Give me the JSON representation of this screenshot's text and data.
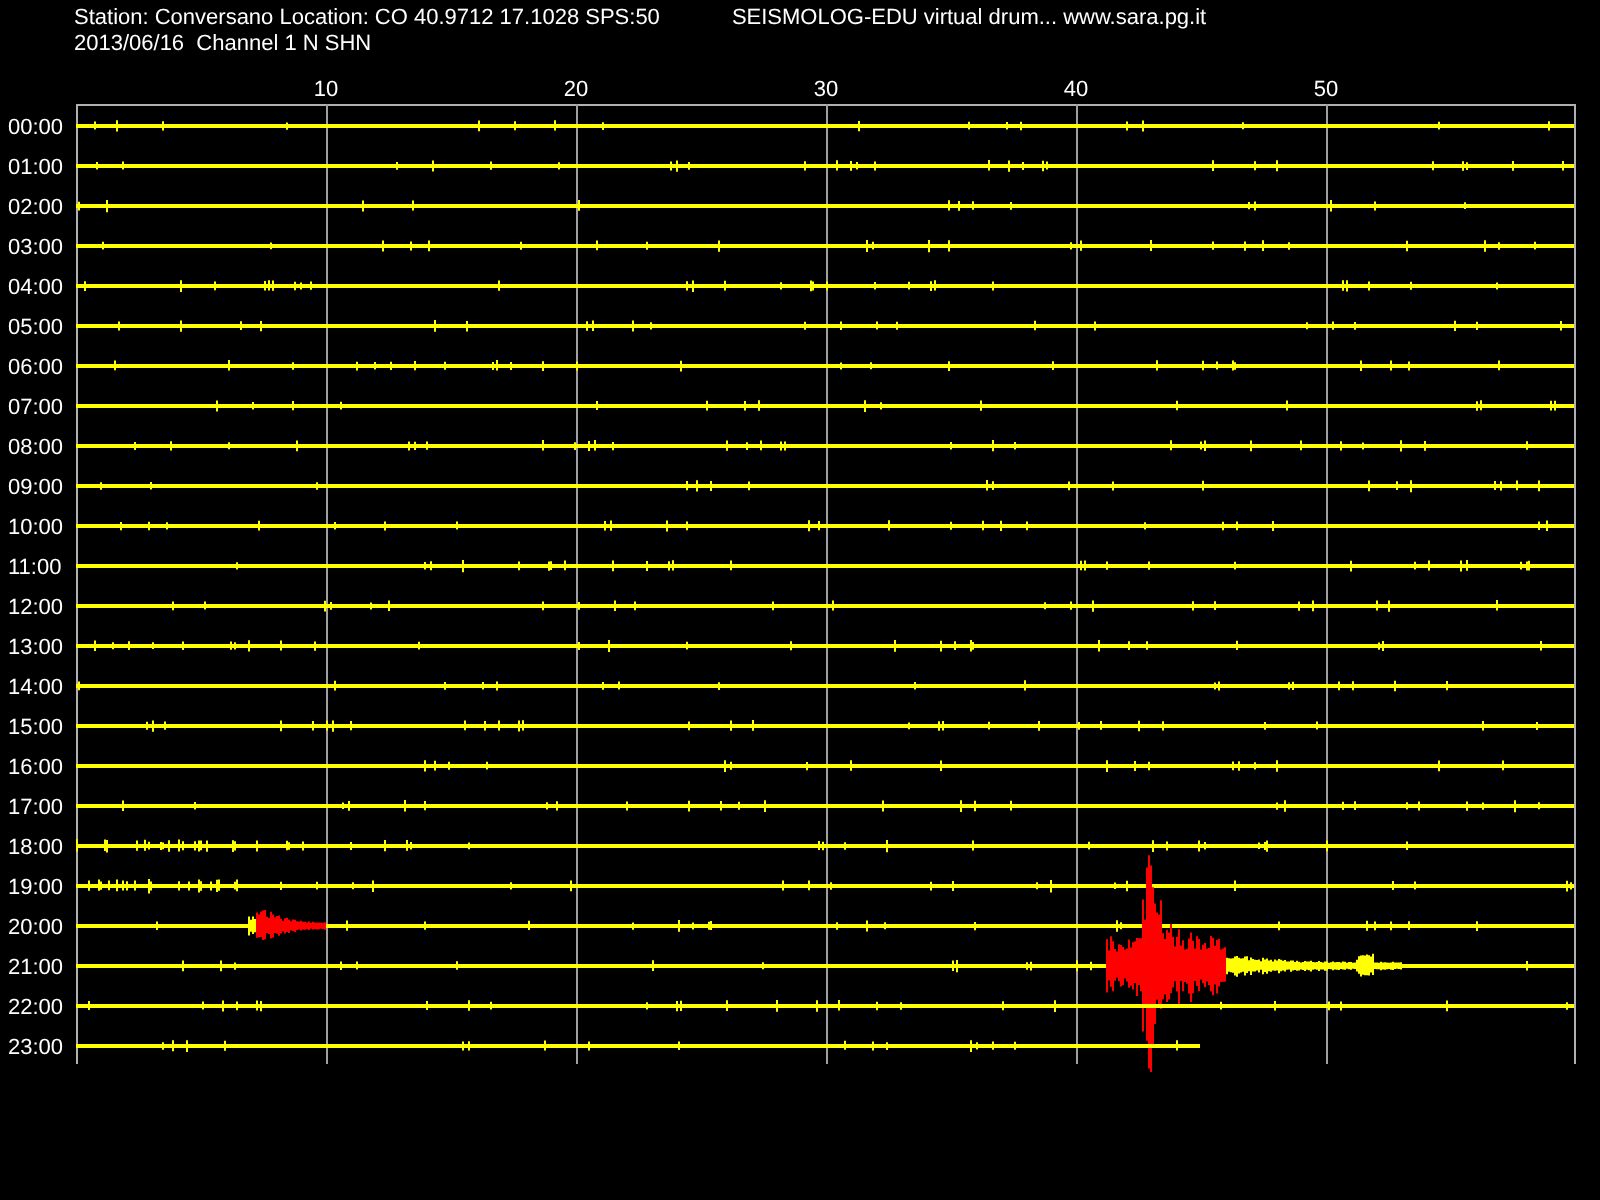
{
  "header": {
    "station": "Station: Conversano Location: CO 40.9712 17.1028 SPS:50",
    "title": "SEISMOLOG-EDU virtual drum... www.sara.pg.it",
    "date_channel": "2013/06/16  Channel 1 N SHN"
  },
  "time_axis": {
    "labels": [
      "10",
      "20",
      "30",
      "40",
      "50"
    ]
  },
  "rows": [
    {
      "label": "00:00"
    },
    {
      "label": "01:00"
    },
    {
      "label": "02:00"
    },
    {
      "label": "03:00"
    },
    {
      "label": "04:00"
    },
    {
      "label": "05:00"
    },
    {
      "label": "06:00"
    },
    {
      "label": "07:00"
    },
    {
      "label": "08:00"
    },
    {
      "label": "09:00"
    },
    {
      "label": "10:00"
    },
    {
      "label": "11:00"
    },
    {
      "label": "12:00"
    },
    {
      "label": "13:00"
    },
    {
      "label": "14:00"
    },
    {
      "label": "15:00"
    },
    {
      "label": "16:00"
    },
    {
      "label": "17:00"
    },
    {
      "label": "18:00"
    },
    {
      "label": "19:00"
    },
    {
      "label": "20:00"
    },
    {
      "label": "21:00"
    },
    {
      "label": "22:00"
    },
    {
      "label": "23:00"
    }
  ]
}
